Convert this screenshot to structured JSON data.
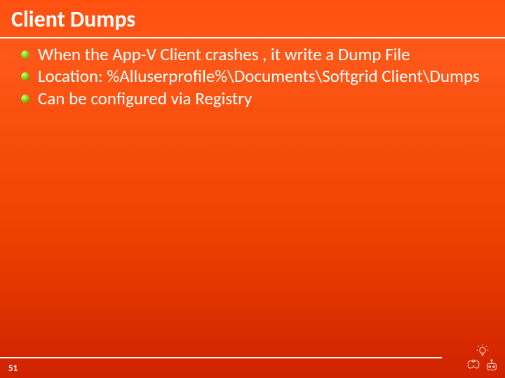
{
  "title": "Client Dumps",
  "bullets": [
    "When the App-V Client crashes , it write a Dump File",
    "Location: %Alluserprofile%\\Documents\\Softgrid Client\\Dumps",
    "Can be configured via Registry"
  ],
  "page_number": "51"
}
